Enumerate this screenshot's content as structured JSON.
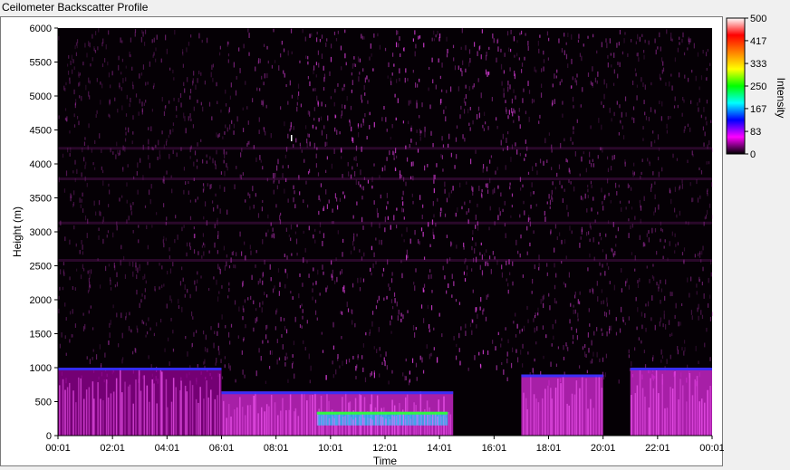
{
  "window": {
    "title": "Ceilometer Backscatter Profile"
  },
  "chart_data": {
    "type": "heatmap",
    "xlabel": "Time",
    "ylabel": "Height (m)",
    "x_ticks": [
      "00:01",
      "02:01",
      "04:01",
      "06:01",
      "08:01",
      "10:01",
      "12:01",
      "14:01",
      "16:01",
      "18:01",
      "20:01",
      "22:01",
      "00:01"
    ],
    "y_ticks": [
      0,
      500,
      1000,
      1500,
      2000,
      2500,
      3000,
      3500,
      4000,
      4500,
      5000,
      5500,
      6000
    ],
    "ylim": [
      0,
      6000
    ],
    "colorbar": {
      "label": "Intensity",
      "ticks": [
        500,
        417,
        333,
        250,
        167,
        83,
        0
      ],
      "range": [
        0,
        500
      ],
      "colors": [
        "#000000",
        "#ff00ff",
        "#0000ff",
        "#00ffff",
        "#00ff00",
        "#ffff00",
        "#ff8000",
        "#ff0000",
        "#ffffff"
      ]
    },
    "background_color": "#050005",
    "features": [
      {
        "name": "aerosol layer 00-06h",
        "t_start": 0.0,
        "t_end": 6.0,
        "h_bottom": 0,
        "h_top": 1000,
        "intensity": 90
      },
      {
        "name": "boundary layer 06-14h",
        "t_start": 6.0,
        "t_end": 14.5,
        "h_bottom": 0,
        "h_top": 650,
        "intensity": 140
      },
      {
        "name": "cloud base 10-14h",
        "t_start": 9.5,
        "t_end": 14.3,
        "h_bottom": 150,
        "h_top": 350,
        "intensity": 320
      },
      {
        "name": "evening layer 17-20h",
        "t_start": 17.0,
        "t_end": 20.0,
        "h_bottom": 0,
        "h_top": 900,
        "intensity": 130
      },
      {
        "name": "late layer 21-24h",
        "t_start": 21.0,
        "t_end": 24.0,
        "h_bottom": 0,
        "h_top": 1000,
        "intensity": 110
      }
    ]
  }
}
